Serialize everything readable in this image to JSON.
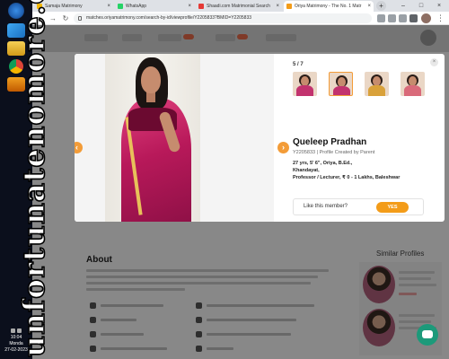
{
  "browser": {
    "tabs": [
      {
        "label": "Samaja Matrimony",
        "color": "#f2b705"
      },
      {
        "label": "WhatsApp",
        "color": "#25d366"
      },
      {
        "label": "Shaadi.com Matrimonial Search",
        "color": "#e53935"
      },
      {
        "label": "Oriya Matrimony - The No. 1 Matr",
        "color": "#f39c19"
      }
    ],
    "url": "matches.oriyamatrimony.com/search-by-id/viewprofile/Y2205833?BMID=Y2205833",
    "new_tab": "+",
    "tab_close": "×",
    "window_controls": {
      "minimize": "–",
      "maximize": "□",
      "close": "×"
    },
    "nav": {
      "back": "←",
      "forward": "→",
      "reload": "↻"
    }
  },
  "taskbar": {
    "time": "10:04",
    "day": "Monda",
    "date": "27-02-2023"
  },
  "watermark": "unfortunatenomore.com",
  "page": {
    "about_title": "About",
    "similar_title": "Similar Profiles"
  },
  "modal": {
    "counter": "5 / 7",
    "name": "Queleep Pradhan",
    "profile_id": "Y2205833",
    "created_by": "Profile Created by Parent",
    "details": [
      "27 yrs, 5' 6\", Oriya, B.Ed.,",
      "Khandayat,",
      "Professor / Lecturer, ₹ 0 - 1 Lakhs, Baleshwar"
    ],
    "like_prompt": "Like this member?",
    "yes_label": "YES",
    "close": "×",
    "prev_arrow": "‹",
    "next_arrow": "›"
  },
  "colors": {
    "accent": "#f39c19",
    "chat_fab": "#1c9a7a"
  }
}
